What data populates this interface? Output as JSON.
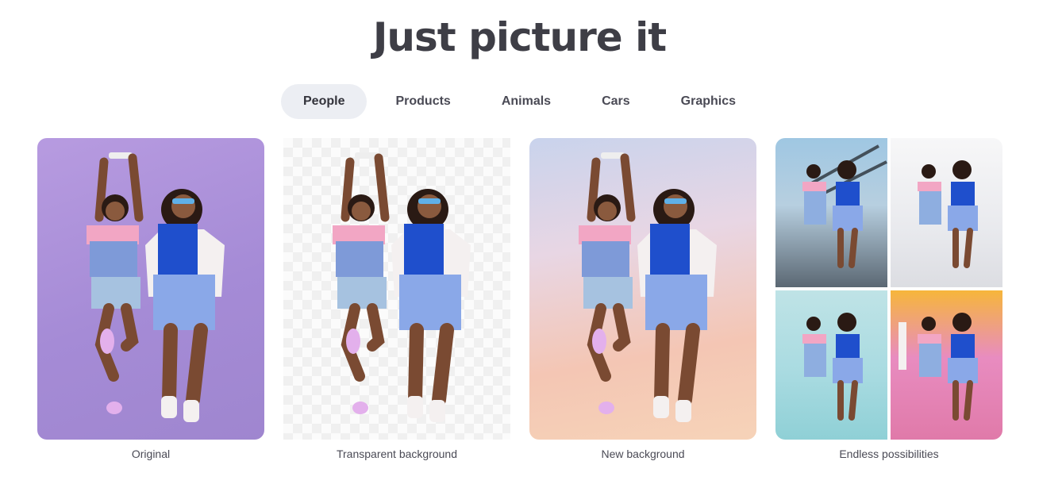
{
  "header": {
    "title": "Just picture it"
  },
  "tabs": [
    {
      "label": "People",
      "active": true
    },
    {
      "label": "Products",
      "active": false
    },
    {
      "label": "Animals",
      "active": false
    },
    {
      "label": "Cars",
      "active": false
    },
    {
      "label": "Graphics",
      "active": false
    }
  ],
  "cards": [
    {
      "caption": "Original"
    },
    {
      "caption": "Transparent background"
    },
    {
      "caption": "New background"
    },
    {
      "caption": "Endless possibilities"
    }
  ],
  "colors": {
    "active_tab_bg": "#eceef3",
    "title": "#3e3e46",
    "original_bg": "#a58bd6"
  }
}
